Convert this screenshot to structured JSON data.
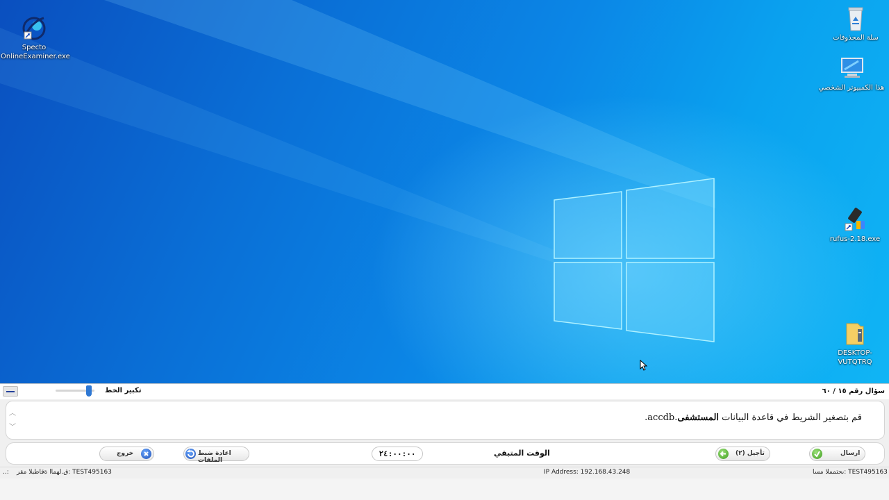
{
  "desktop": {
    "icons": [
      {
        "name": "specto",
        "label_line1": "Specto",
        "label_line2": "OnlineExaminer.exe"
      },
      {
        "name": "recycle-bin",
        "label": "سلة المحذوفات"
      },
      {
        "name": "this-pc",
        "label": "هذا الكمبيوتر الشخصي"
      },
      {
        "name": "rufus",
        "label": "rufus-2.18.exe"
      },
      {
        "name": "desktop-folder",
        "label": "DESKTOP-VUTQTRQ"
      }
    ]
  },
  "exam": {
    "zoom_label": "تكبير الخط",
    "zoom_level": 0.85,
    "question_number": "سؤال رقم ١٥ / ٦٠",
    "question": {
      "text_before": "قم بتصغير الشريط في قاعدة البيانات ",
      "text_bold": "المستشفى",
      "text_after": ".accdb."
    },
    "buttons": {
      "send": "ارسال",
      "postpone": "تأجيل (٢)",
      "reset_files": "اعادة ضبط الملفات",
      "exit": "خروج"
    },
    "remaining_label": "الوقت المتبقي",
    "timer": "٢٤:٠٠:٠٠"
  },
  "status": {
    "left": "ق.لهماا ةقاطبلا مقر: TEST495163",
    "middle": "IP Address: 192.168.43.248",
    "right": "ىحتمملا مسا: TEST495163",
    "dots": "..:"
  },
  "colors": {
    "desktop_accent": "#0a6fd6",
    "logo_light": "#7fe3ff",
    "send_icon": "#3f9d1e",
    "exit_icon": "#1f4fb5"
  }
}
